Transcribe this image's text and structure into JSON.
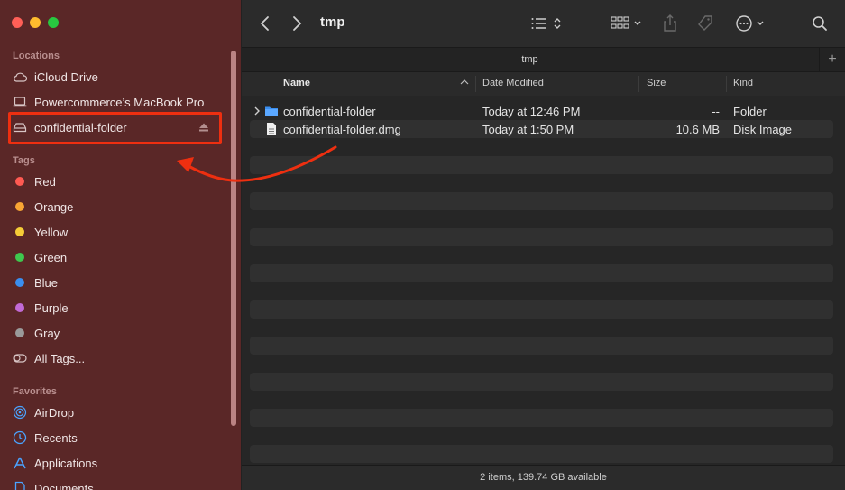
{
  "window": {
    "title": "tmp",
    "tab_label": "tmp"
  },
  "sidebar": {
    "locations_title": "Locations",
    "locations": [
      {
        "label": "iCloud Drive",
        "icon": "cloud-icon"
      },
      {
        "label": "Powercommerce’s MacBook Pro",
        "icon": "laptop-icon"
      },
      {
        "label": "confidential-folder",
        "icon": "drive-icon",
        "eject_icon": "eject-icon"
      }
    ],
    "tags_title": "Tags",
    "tags": [
      {
        "label": "Red",
        "color": "#ff5a52"
      },
      {
        "label": "Orange",
        "color": "#f8a534"
      },
      {
        "label": "Yellow",
        "color": "#f5cc37"
      },
      {
        "label": "Green",
        "color": "#3fc74e"
      },
      {
        "label": "Blue",
        "color": "#3a8eef"
      },
      {
        "label": "Purple",
        "color": "#c26ad5"
      },
      {
        "label": "Gray",
        "color": "#9a9a9a"
      },
      {
        "label": "All Tags...",
        "icon": "all-tags-icon"
      }
    ],
    "favorites_title": "Favorites",
    "favorites": [
      {
        "label": "AirDrop",
        "icon": "airdrop-icon"
      },
      {
        "label": "Recents",
        "icon": "clock-icon"
      },
      {
        "label": "Applications",
        "icon": "applications-icon"
      },
      {
        "label": "Documents",
        "icon": "document-icon"
      }
    ]
  },
  "columns": {
    "name": "Name",
    "date": "Date Modified",
    "size": "Size",
    "kind": "Kind"
  },
  "files": [
    {
      "name": "confidential-folder",
      "date": "Today at 12:46 PM",
      "size": "--",
      "kind": "Folder",
      "icon": "folder-icon"
    },
    {
      "name": "confidential-folder.dmg",
      "date": "Today at 1:50 PM",
      "size": "10.6 MB",
      "kind": "Disk Image",
      "icon": "file-icon"
    }
  ],
  "status": "2 items, 139.74 GB available",
  "colors": {
    "sidebar": "#5a2727",
    "highlight": "#ee2f10",
    "accent": "#3a8eef"
  }
}
